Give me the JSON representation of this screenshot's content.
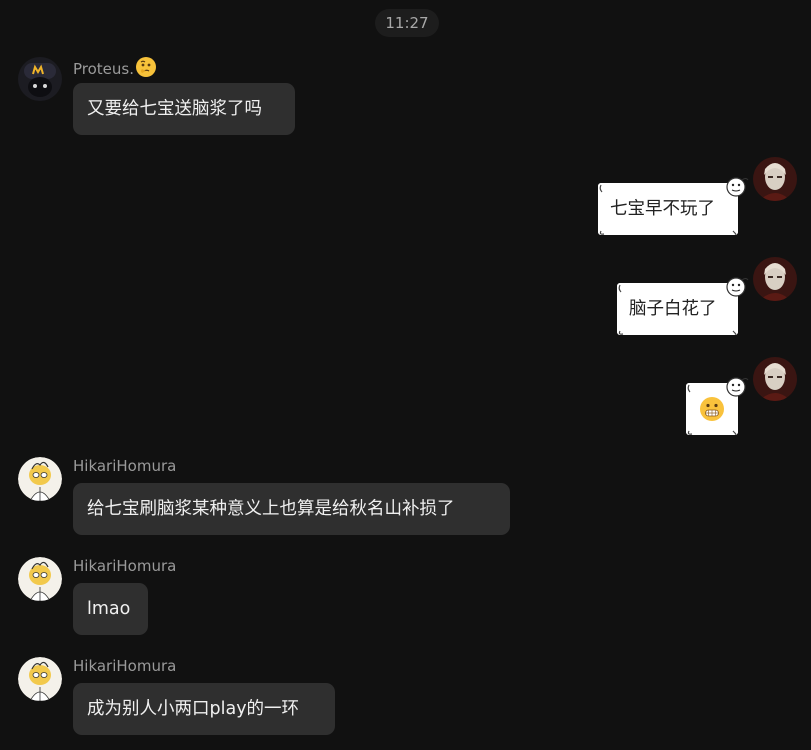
{
  "timestamp": "11:27",
  "messages": [
    {
      "sender": "Proteus.",
      "sender_emoji": "thinking-face-emoji",
      "text": "又要给七宝送脑浆了吗",
      "direction": "incoming"
    },
    {
      "text": "七宝早不玩了",
      "direction": "outgoing"
    },
    {
      "text": "脑子白花了",
      "direction": "outgoing"
    },
    {
      "emoji": "grimacing-face-emoji",
      "direction": "outgoing"
    },
    {
      "sender": "HikariHomura",
      "text": "给七宝刷脑浆某种意义上也算是给秋名山补损了",
      "direction": "incoming"
    },
    {
      "sender": "HikariHomura",
      "text": "lmao",
      "direction": "incoming"
    },
    {
      "sender": "HikariHomura",
      "text": "成为别人小两口play的一环",
      "direction": "incoming"
    }
  ],
  "colors": {
    "background": "#111111",
    "incoming_bubble": "#2f2f2f",
    "outgoing_bubble": "#ffffff",
    "sender_name": "#9a9a9a"
  }
}
